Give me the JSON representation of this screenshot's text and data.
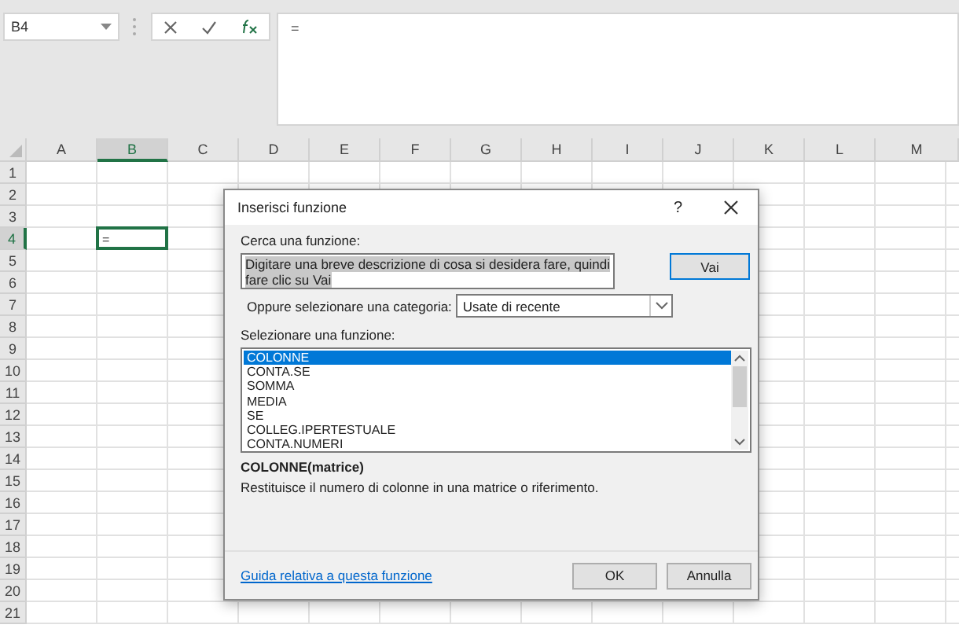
{
  "name_box": {
    "value": "B4"
  },
  "formula_bar": {
    "value": "="
  },
  "columns": [
    {
      "label": "A",
      "selected": false
    },
    {
      "label": "B",
      "selected": true
    },
    {
      "label": "C",
      "selected": false
    },
    {
      "label": "D",
      "selected": false
    },
    {
      "label": "E",
      "selected": false
    },
    {
      "label": "F",
      "selected": false
    },
    {
      "label": "G",
      "selected": false
    },
    {
      "label": "H",
      "selected": false
    },
    {
      "label": "I",
      "selected": false
    },
    {
      "label": "J",
      "selected": false
    },
    {
      "label": "K",
      "selected": false
    },
    {
      "label": "L",
      "selected": false
    },
    {
      "label": "M",
      "selected": false
    }
  ],
  "rows": [
    {
      "label": "1",
      "selected": false
    },
    {
      "label": "2",
      "selected": false
    },
    {
      "label": "3",
      "selected": false
    },
    {
      "label": "4",
      "selected": true
    },
    {
      "label": "5",
      "selected": false
    },
    {
      "label": "6",
      "selected": false
    },
    {
      "label": "7",
      "selected": false
    },
    {
      "label": "8",
      "selected": false
    },
    {
      "label": "9",
      "selected": false
    },
    {
      "label": "10",
      "selected": false
    },
    {
      "label": "11",
      "selected": false
    },
    {
      "label": "12",
      "selected": false
    },
    {
      "label": "13",
      "selected": false
    },
    {
      "label": "14",
      "selected": false
    },
    {
      "label": "15",
      "selected": false
    },
    {
      "label": "16",
      "selected": false
    },
    {
      "label": "17",
      "selected": false
    },
    {
      "label": "18",
      "selected": false
    },
    {
      "label": "19",
      "selected": false
    },
    {
      "label": "20",
      "selected": false
    },
    {
      "label": "21",
      "selected": false
    }
  ],
  "active_cell": {
    "value": "="
  },
  "dialog": {
    "title": "Inserisci funzione",
    "help": "?",
    "search_label": "Cerca una funzione:",
    "search_value": "Digitare una breve descrizione di cosa si desidera fare, quindi fare clic su Vai",
    "go_button": "Vai",
    "category_label": "Oppure selezionare una categoria:",
    "category_value": "Usate di recente",
    "list_label": "Selezionare una funzione:",
    "functions": [
      {
        "name": "COLONNE",
        "selected": true
      },
      {
        "name": "CONTA.SE",
        "selected": false
      },
      {
        "name": "SOMMA",
        "selected": false
      },
      {
        "name": "MEDIA",
        "selected": false
      },
      {
        "name": "SE",
        "selected": false
      },
      {
        "name": "COLLEG.IPERTESTUALE",
        "selected": false
      },
      {
        "name": "CONTA.NUMERI",
        "selected": false
      }
    ],
    "signature": "COLONNE(matrice)",
    "description": "Restituisce il numero di colonne in una matrice o riferimento.",
    "help_link": "Guida relativa a questa funzione",
    "buttons": [
      "OK",
      "Annulla"
    ]
  }
}
